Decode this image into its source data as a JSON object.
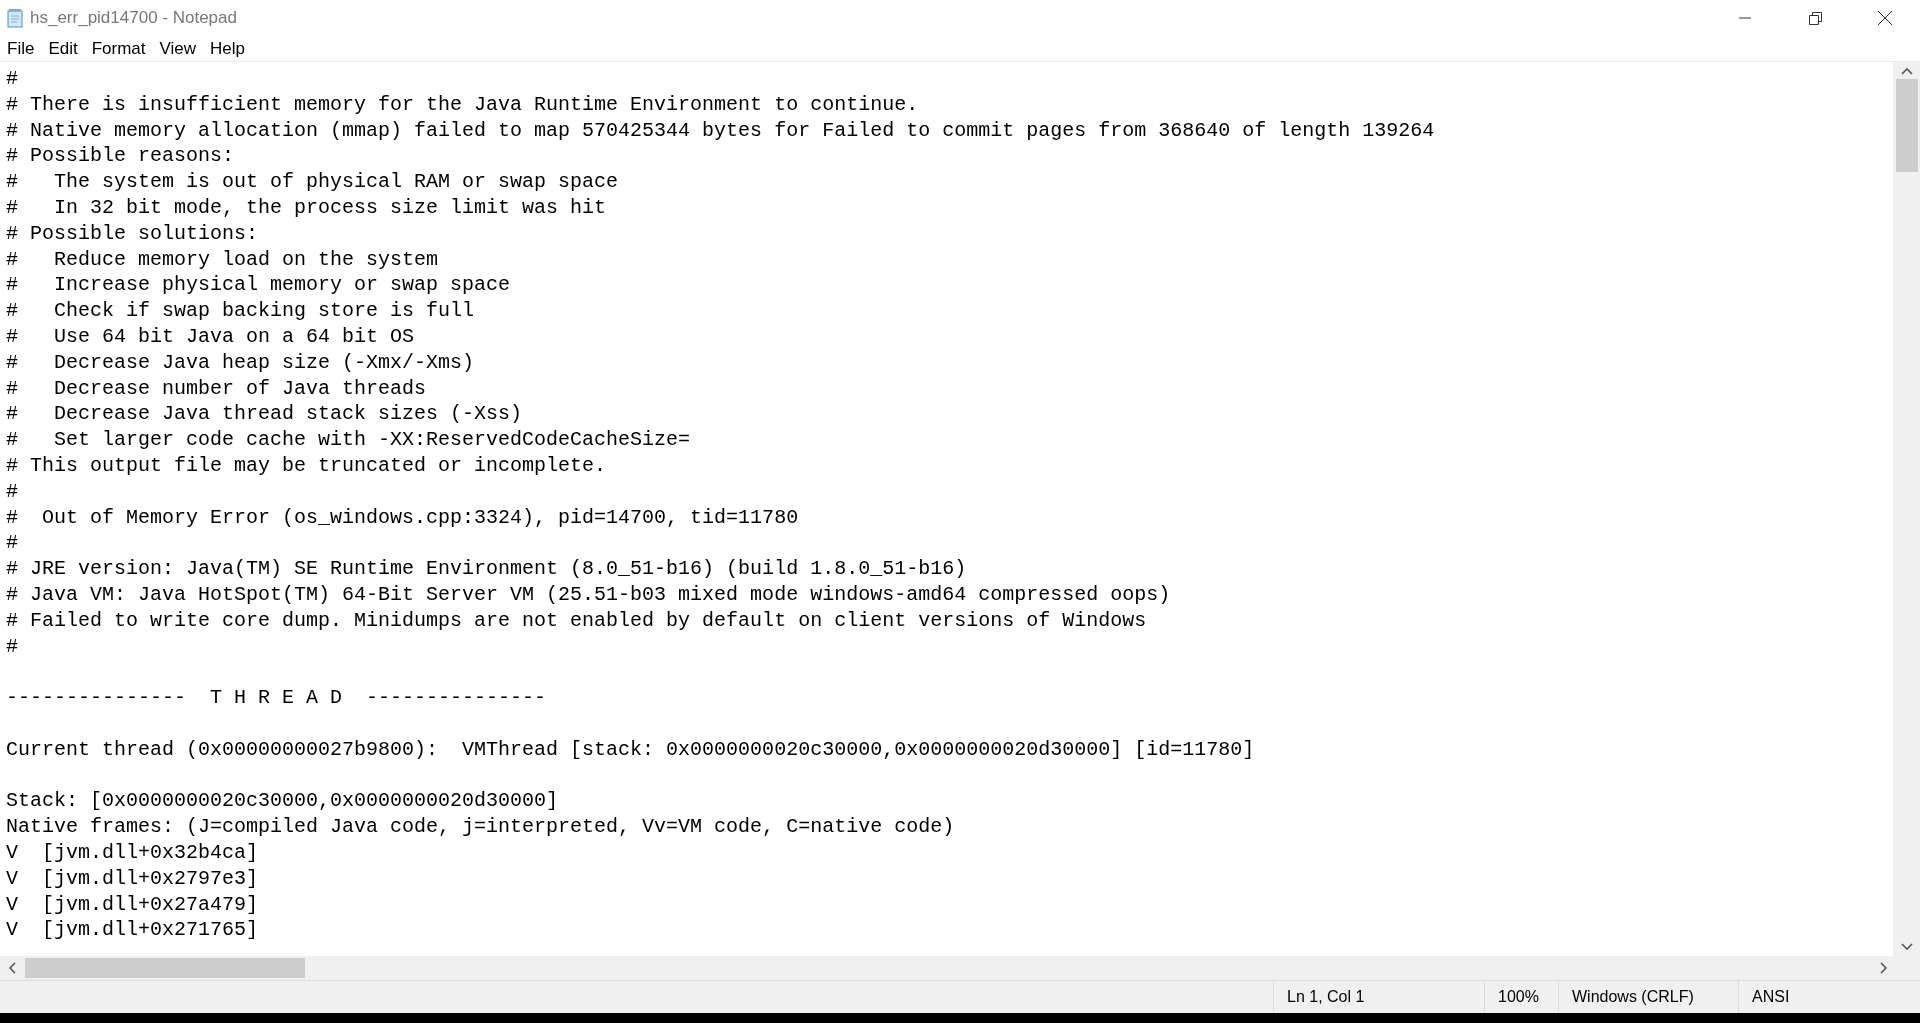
{
  "window": {
    "title": "hs_err_pid14700 - Notepad"
  },
  "menu": [
    "File",
    "Edit",
    "Format",
    "View",
    "Help"
  ],
  "blocks": [
    [
      "#",
      "# There is insufficient memory for the Java Runtime Environment to continue.",
      "# Native memory allocation (mmap) failed to map 570425344 bytes for Failed to commit pages from 368640 of length 139264",
      "# Possible reasons:",
      "#   The system is out of physical RAM or swap space",
      "#   In 32 bit mode, the process size limit was hit",
      "# Possible solutions:",
      "#   Reduce memory load on the system",
      "#   Increase physical memory or swap space",
      "#   Check if swap backing store is full",
      "#   Use 64 bit Java on a 64 bit OS",
      "#   Decrease Java heap size (-Xmx/-Xms)",
      "#   Decrease number of Java threads",
      "#   Decrease Java thread stack sizes (-Xss)",
      "#   Set larger code cache with -XX:ReservedCodeCacheSize=",
      "# This output file may be truncated or incomplete.",
      "#",
      "#  Out of Memory Error (os_windows.cpp:3324), pid=14700, tid=11780",
      "#",
      "# JRE version: Java(TM) SE Runtime Environment (8.0_51-b16) (build 1.8.0_51-b16)",
      "# Java VM: Java HotSpot(TM) 64-Bit Server VM (25.51-b03 mixed mode windows-amd64 compressed oops)",
      "# Failed to write core dump. Minidumps are not enabled by default on client versions of Windows",
      "#"
    ],
    [
      "---------------  T H R E A D  ---------------"
    ],
    [
      "Current thread (0x00000000027b9800):  VMThread [stack: 0x0000000020c30000,0x0000000020d30000] [id=11780]"
    ],
    [
      "Stack: [0x0000000020c30000,0x0000000020d30000]",
      "Native frames: (J=compiled Java code, j=interpreted, Vv=VM code, C=native code)",
      "V  [jvm.dll+0x32b4ca]",
      "V  [jvm.dll+0x2797e3]",
      "V  [jvm.dll+0x27a479]",
      "V  [jvm.dll+0x271765]"
    ]
  ],
  "status_bar": [
    "Ln 1, Col 1",
    "100%",
    "Windows (CRLF)",
    "ANSI"
  ]
}
